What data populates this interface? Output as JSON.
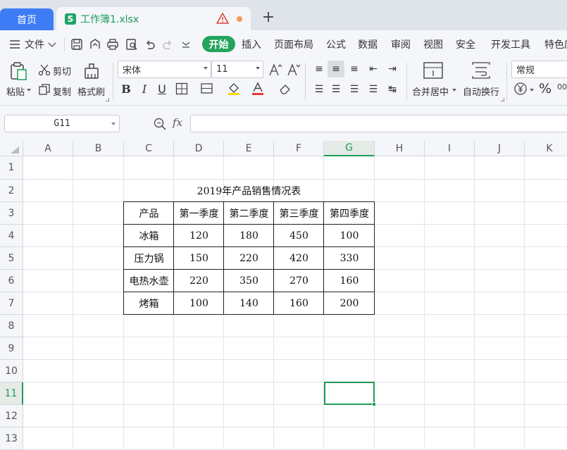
{
  "tabs": {
    "home": "首页",
    "file": "工作簿1.xlsx",
    "file_logo": "S",
    "add": "+"
  },
  "menu": {
    "file": "文件",
    "start": "开始",
    "items": [
      "插入",
      "页面布局",
      "公式",
      "数据",
      "审阅",
      "视图",
      "安全",
      "开发工具",
      "特色应"
    ]
  },
  "toolbar": {
    "paste": "粘贴",
    "cut": "剪切",
    "copy": "复制",
    "format_painter": "格式刷",
    "font_name": "宋体",
    "font_size": "11",
    "merge_center": "合并居中",
    "wrap_text": "自动换行",
    "number_format": "常规",
    "percent": "%"
  },
  "formula_bar": {
    "name_box": "G11",
    "fx": "fx",
    "value": ""
  },
  "sheet": {
    "columns": [
      "A",
      "B",
      "C",
      "D",
      "E",
      "F",
      "G",
      "H",
      "I",
      "J",
      "K"
    ],
    "rows": [
      "1",
      "2",
      "3",
      "4",
      "5",
      "6",
      "7",
      "8",
      "9",
      "10",
      "11",
      "12",
      "13"
    ],
    "selected_cell": "G11",
    "title": "2019年产品销售情况表",
    "table": {
      "headers": [
        "产品",
        "第一季度",
        "第二季度",
        "第三季度",
        "第四季度"
      ],
      "rows": [
        [
          "冰箱",
          "120",
          "180",
          "450",
          "100"
        ],
        [
          "压力锅",
          "150",
          "220",
          "420",
          "330"
        ],
        [
          "电热水壶",
          "220",
          "350",
          "270",
          "160"
        ],
        [
          "烤箱",
          "100",
          "140",
          "160",
          "200"
        ]
      ]
    }
  },
  "colors": {
    "accent_green": "#1d9c5d",
    "home_tab_blue": "#3d7cf5",
    "modified_dot": "#f29a5c"
  }
}
